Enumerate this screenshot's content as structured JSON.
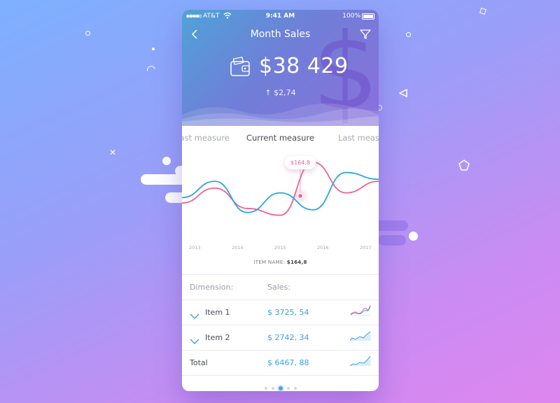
{
  "status_bar": {
    "carrier": "AT&T",
    "time": "9:41 AM",
    "battery": "100%"
  },
  "header": {
    "title": "Month Sales",
    "amount": "$38 429",
    "change": "↑ $2,74",
    "icons": [
      "back-arrow-icon",
      "filter-icon",
      "wallet-icon",
      "dollar-sign-icon"
    ]
  },
  "tabs": {
    "previous": "Last measure",
    "current": "Current measure",
    "next": "Last measure"
  },
  "chart_data": {
    "type": "line",
    "x": [
      "2013",
      "2014",
      "2015",
      "2016",
      "2017"
    ],
    "tooltip": "$164,8",
    "series": [
      {
        "color": "#f06292",
        "values": [
          0.4,
          0.62,
          0.32,
          0.22,
          1.0,
          0.55,
          0.72
        ]
      },
      {
        "color": "#29a8de",
        "values": [
          0.48,
          0.72,
          0.26,
          0.55,
          0.3,
          0.85,
          0.75
        ]
      }
    ],
    "caption_label": "ITEM NAME:",
    "caption_value": "$164,8"
  },
  "table": {
    "headers": {
      "dimension": "Dimension:",
      "sales": "Sales:"
    },
    "rows": [
      {
        "label": "Item 1",
        "value": "$ 3725, 54"
      },
      {
        "label": "Item 2",
        "value": "$ 2742, 34"
      },
      {
        "label": "Total",
        "value": "$ 6467, 88"
      }
    ]
  },
  "pager": {
    "pages": 5,
    "active": 2
  },
  "colors": {
    "accent_blue": "#29a8de",
    "accent_pink": "#f06292",
    "header_start": "#4fa3d8",
    "header_end": "#8b6fdc"
  }
}
